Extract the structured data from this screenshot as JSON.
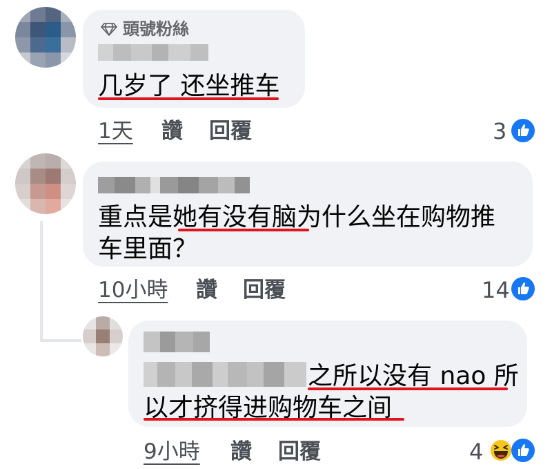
{
  "comments": [
    {
      "badge": "頭號粉絲",
      "line1": "几岁了 还坐推车",
      "time": "1天",
      "like_action": "讚",
      "reply_action": "回覆",
      "reactions": "3"
    },
    {
      "line1": "重点是她有没有脑为什么坐在购物推",
      "line2": "车里面？",
      "time": "10小時",
      "like_action": "讚",
      "reply_action": "回覆",
      "reactions": "14"
    },
    {
      "line1": "之所以没有 nao 所",
      "line2": "以才挤得进购物车之间",
      "time": "9小時",
      "like_action": "讚",
      "reply_action": "回覆",
      "reactions": "4"
    }
  ],
  "icons": {
    "badge": "diamond-icon",
    "like": "thumbs-up-icon",
    "haha": "laughing-emoji-icon"
  },
  "colors": {
    "bubble": "#f0f2f5",
    "underline": "#e0141e",
    "like_blue": "#1877f2",
    "meta_text": "#4b4f56"
  }
}
